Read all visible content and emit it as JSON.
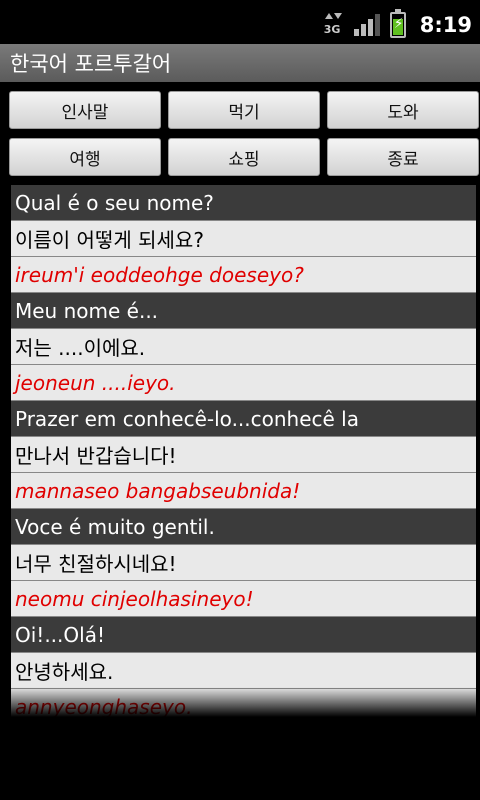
{
  "status_bar": {
    "network_label": "3G",
    "time": "8:19",
    "battery_level": 0.75,
    "signal_bars": 3
  },
  "app": {
    "title": "한국어 포르투갈어"
  },
  "categories": [
    {
      "label": "인사말"
    },
    {
      "label": "먹기"
    },
    {
      "label": "도와"
    },
    {
      "label": "여행"
    },
    {
      "label": "쇼핑"
    },
    {
      "label": "종료"
    }
  ],
  "phrases": [
    {
      "portuguese": "Qual é o seu nome?",
      "korean": "이름이 어떻게 되세요?",
      "romanization": "ireum'i eoddeohge doeseyo?"
    },
    {
      "portuguese": "Meu nome é...",
      "korean": "저는 ....이에요.",
      "romanization": "jeoneun ....ieyo."
    },
    {
      "portuguese": "Prazer em conhecê-lo...conhecê la",
      "korean": "만나서 반갑습니다!",
      "romanization": "mannaseo bangabseubnida!"
    },
    {
      "portuguese": "Voce é muito gentil.",
      "korean": "너무 친절하시네요!",
      "romanization": "neomu cinjeolhasineyo!"
    },
    {
      "portuguese": "Oi!...Olá!",
      "korean": "안녕하세요.",
      "romanization": "annyeonghaseyo."
    }
  ],
  "colors": {
    "portuguese_row_bg": "#3b3b3b",
    "translation_row_bg": "#e9e9e9",
    "romanization_text": "#e00000",
    "battery_fill": "#5fbf1f"
  }
}
